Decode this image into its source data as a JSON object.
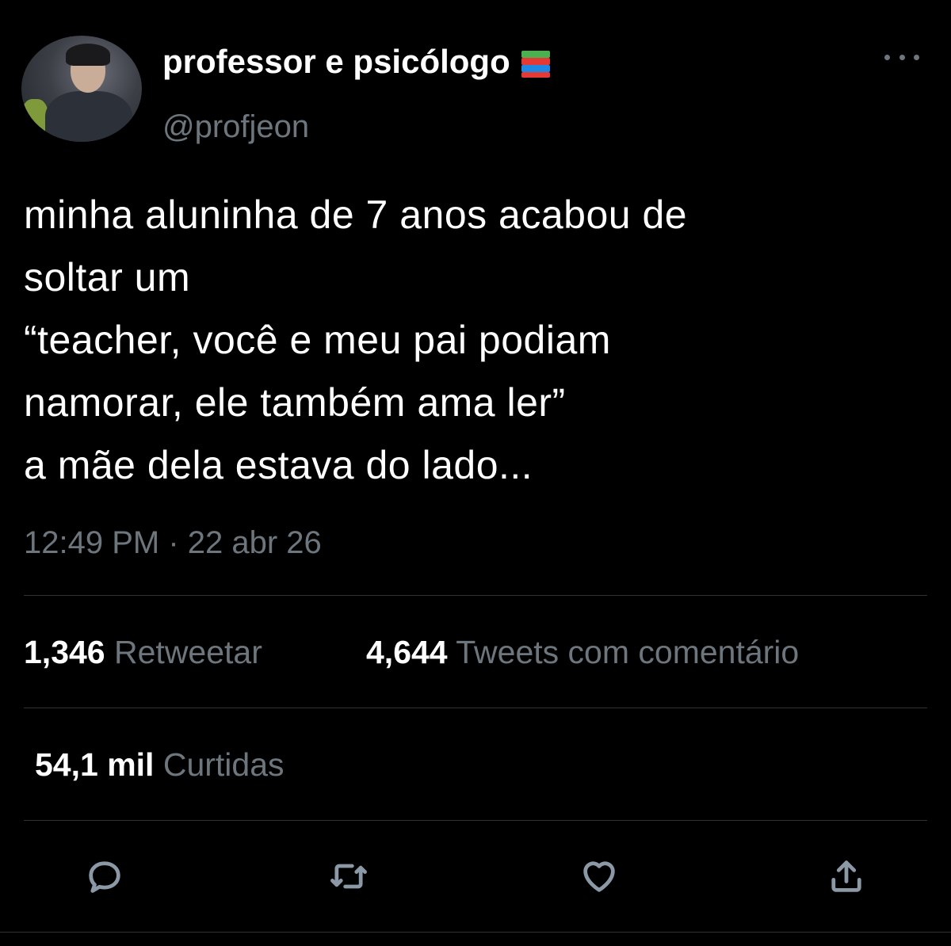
{
  "author": {
    "display_name": "professor e psicólogo",
    "name_emoji": "books-emoji",
    "handle": "@profjeon",
    "avatar_icon": "user-avatar"
  },
  "tweet": {
    "text": "minha aluninha de 7 anos acabou de\nsoltar um\n“teacher, você e meu pai podiam\nnamorar, ele também ama ler”\na mãe dela estava do lado...",
    "timestamp": "12:49 PM · 22 abr 26"
  },
  "stats": {
    "retweets_count": "1,346",
    "retweets_label": "Retweetar",
    "quotes_count": "4,644",
    "quotes_label": "Tweets com comentário",
    "likes_count": "54,1 mil",
    "likes_label": "Curtidas"
  },
  "actions": {
    "reply_icon": "reply-icon",
    "retweet_icon": "retweet-icon",
    "like_icon": "heart-icon",
    "share_icon": "share-icon",
    "more_icon": "more-icon"
  },
  "colors": {
    "background": "#000000",
    "primary_text": "#ffffff",
    "secondary_text": "#6e767d",
    "divider": "#2f3336",
    "icon": "#8b98a5"
  }
}
